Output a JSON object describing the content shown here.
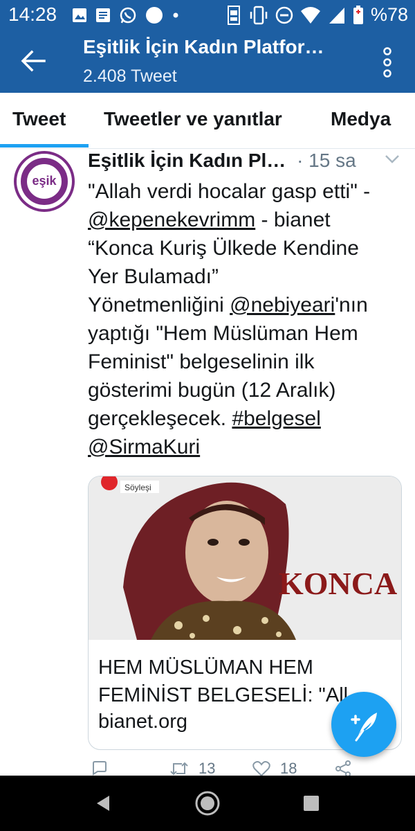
{
  "status_bar": {
    "time": "14:28",
    "battery_percent": "%78",
    "icons_left": [
      "image-icon",
      "message-icon",
      "whatsapp-icon",
      "circle-icon",
      "dot-icon"
    ],
    "icons_right": [
      "volte-icon",
      "vibrate-icon",
      "dnd-icon",
      "wifi-icon",
      "signal-icon",
      "battery-icon"
    ]
  },
  "app_bar": {
    "title": "Eşitlik İçin Kadın Platfor…",
    "subtitle": "2.408 Tweet"
  },
  "tabs": [
    {
      "label": "Tweet",
      "active": true
    },
    {
      "label": "Tweetler ve yanıtlar",
      "active": false
    },
    {
      "label": "Medya",
      "active": false
    }
  ],
  "tweet": {
    "avatar_text": "eşik",
    "author_name": "Eşitlik İçin Kadın Pl…",
    "time": "· 15 sa",
    "text_lines": [
      [
        "\"Allah verdi hocalar gasp etti\" -"
      ],
      [
        "@kepenekevrimm",
        " - bianet"
      ],
      [
        "“Konca Kuriş Ülkede Kendine"
      ],
      [
        "Yer Bulamadı”"
      ],
      [
        "Yönetmenliğini ",
        "@nebiyeari",
        "'nın"
      ],
      [
        "yaptığı \"Hem Müslüman Hem"
      ],
      [
        "Feminist\" belgeselinin ilk"
      ],
      [
        "gösterimi bugün (12 Aralık)"
      ],
      [
        "gerçekleşecek. ",
        "#belgesel"
      ],
      [
        "@SirmaKuri"
      ]
    ],
    "card": {
      "image_badge": "Söyleşi",
      "image_caption": "KONCA",
      "title_line1": "HEM MÜSLÜMAN HEM",
      "title_line2": "FEMİNİST BELGESELİ: \"All",
      "domain": "bianet.org"
    },
    "actions": {
      "reply_count": "",
      "retweet_count": "13",
      "like_count": "18"
    }
  },
  "colors": {
    "app_bar": "#1d5fa3",
    "accent": "#1da1f2",
    "avatar_ring": "#7b2c86",
    "konca_red": "#8b1a1a"
  }
}
